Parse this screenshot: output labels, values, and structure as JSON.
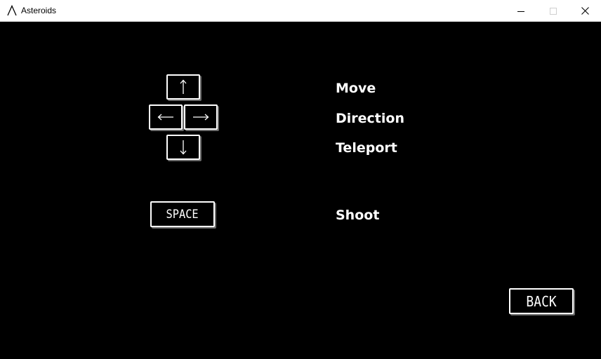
{
  "window": {
    "title": "Asteroids",
    "icon": "asteroids-a-icon",
    "controls": [
      "minimize-icon",
      "maximize-icon",
      "close-icon"
    ]
  },
  "controls": {
    "arrow_keys": {
      "up": "↑",
      "left": "←",
      "right": "→",
      "down": "↓"
    },
    "space_key": "SPACE",
    "actions": {
      "move": "Move",
      "direction": "Direction",
      "teleport": "Teleport",
      "shoot": "Shoot"
    }
  },
  "navigation": {
    "back_label": "BACK"
  },
  "colors": {
    "background": "#000000",
    "foreground": "#ffffff",
    "key_shadow": "#6a6a6a",
    "titlebar": "#ffffff"
  }
}
